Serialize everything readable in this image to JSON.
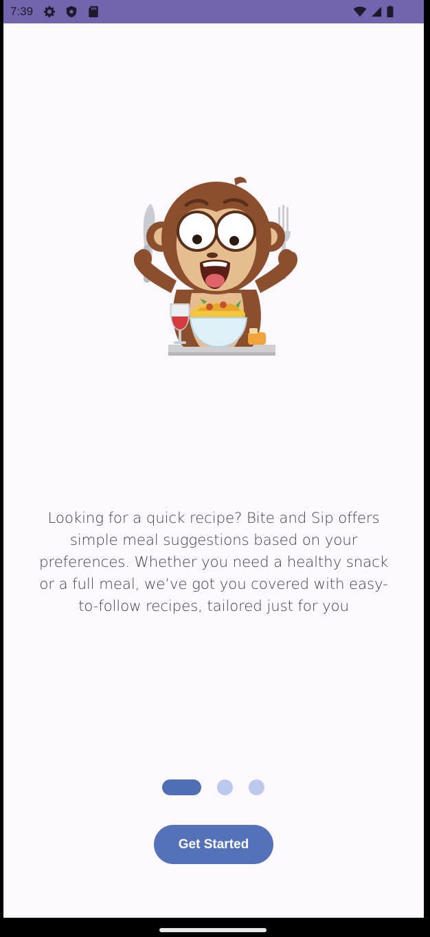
{
  "status_bar": {
    "time": "7:39",
    "icons": [
      "gear-icon",
      "shield-icon",
      "sd-card-icon",
      "wifi-icon",
      "signal-icon",
      "battery-icon"
    ],
    "background": "#7264ad"
  },
  "onboarding": {
    "illustration": "monkey-eating-icon",
    "description": "Looking for a quick recipe? Bite and Sip offers simple meal suggestions based on your preferences. Whether you need a healthy snack or a full meal, we’ve got you covered with easy-to-follow recipes, tailored just for you",
    "pager": {
      "total": 3,
      "active": 1
    },
    "cta_label": "Get Started"
  },
  "colors": {
    "accent": "#5472b9",
    "dot_inactive": "#bcc8ec",
    "background": "#fdf8fd"
  }
}
